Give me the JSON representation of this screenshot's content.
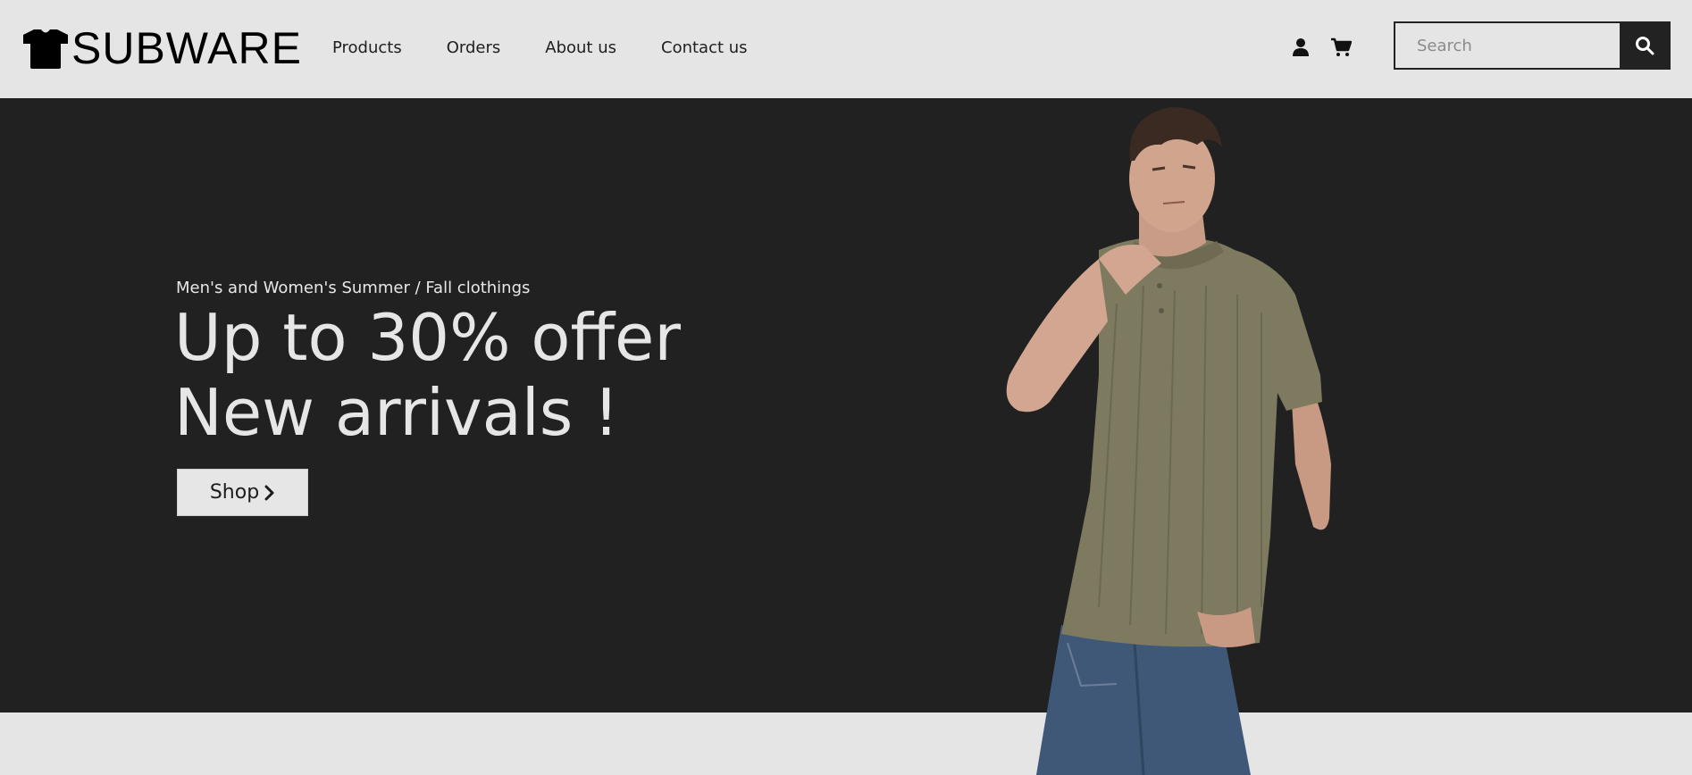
{
  "brand": {
    "name": "SUBWARE",
    "logo_icon": "tshirt-icon"
  },
  "nav": {
    "items": [
      {
        "label": "Products"
      },
      {
        "label": "Orders"
      },
      {
        "label": "About us"
      },
      {
        "label": "Contact us"
      }
    ]
  },
  "header_icons": {
    "account": "user-icon",
    "cart": "cart-icon"
  },
  "search": {
    "placeholder": "Search",
    "value": "",
    "icon": "search-icon"
  },
  "hero": {
    "kicker": "Men's and Women's Summer / Fall clothings",
    "headline_line1": "Up to 30% offer",
    "headline_line2": "New arrivals !",
    "cta_label": "Shop",
    "cta_icon": "chevron-right-icon",
    "image": "model-wearing-olive-polo-and-jeans"
  },
  "colors": {
    "header_bg": "#e5e5e5",
    "hero_bg": "#212121",
    "shirt": "#7d7a5f",
    "jeans": "#3f5878"
  }
}
